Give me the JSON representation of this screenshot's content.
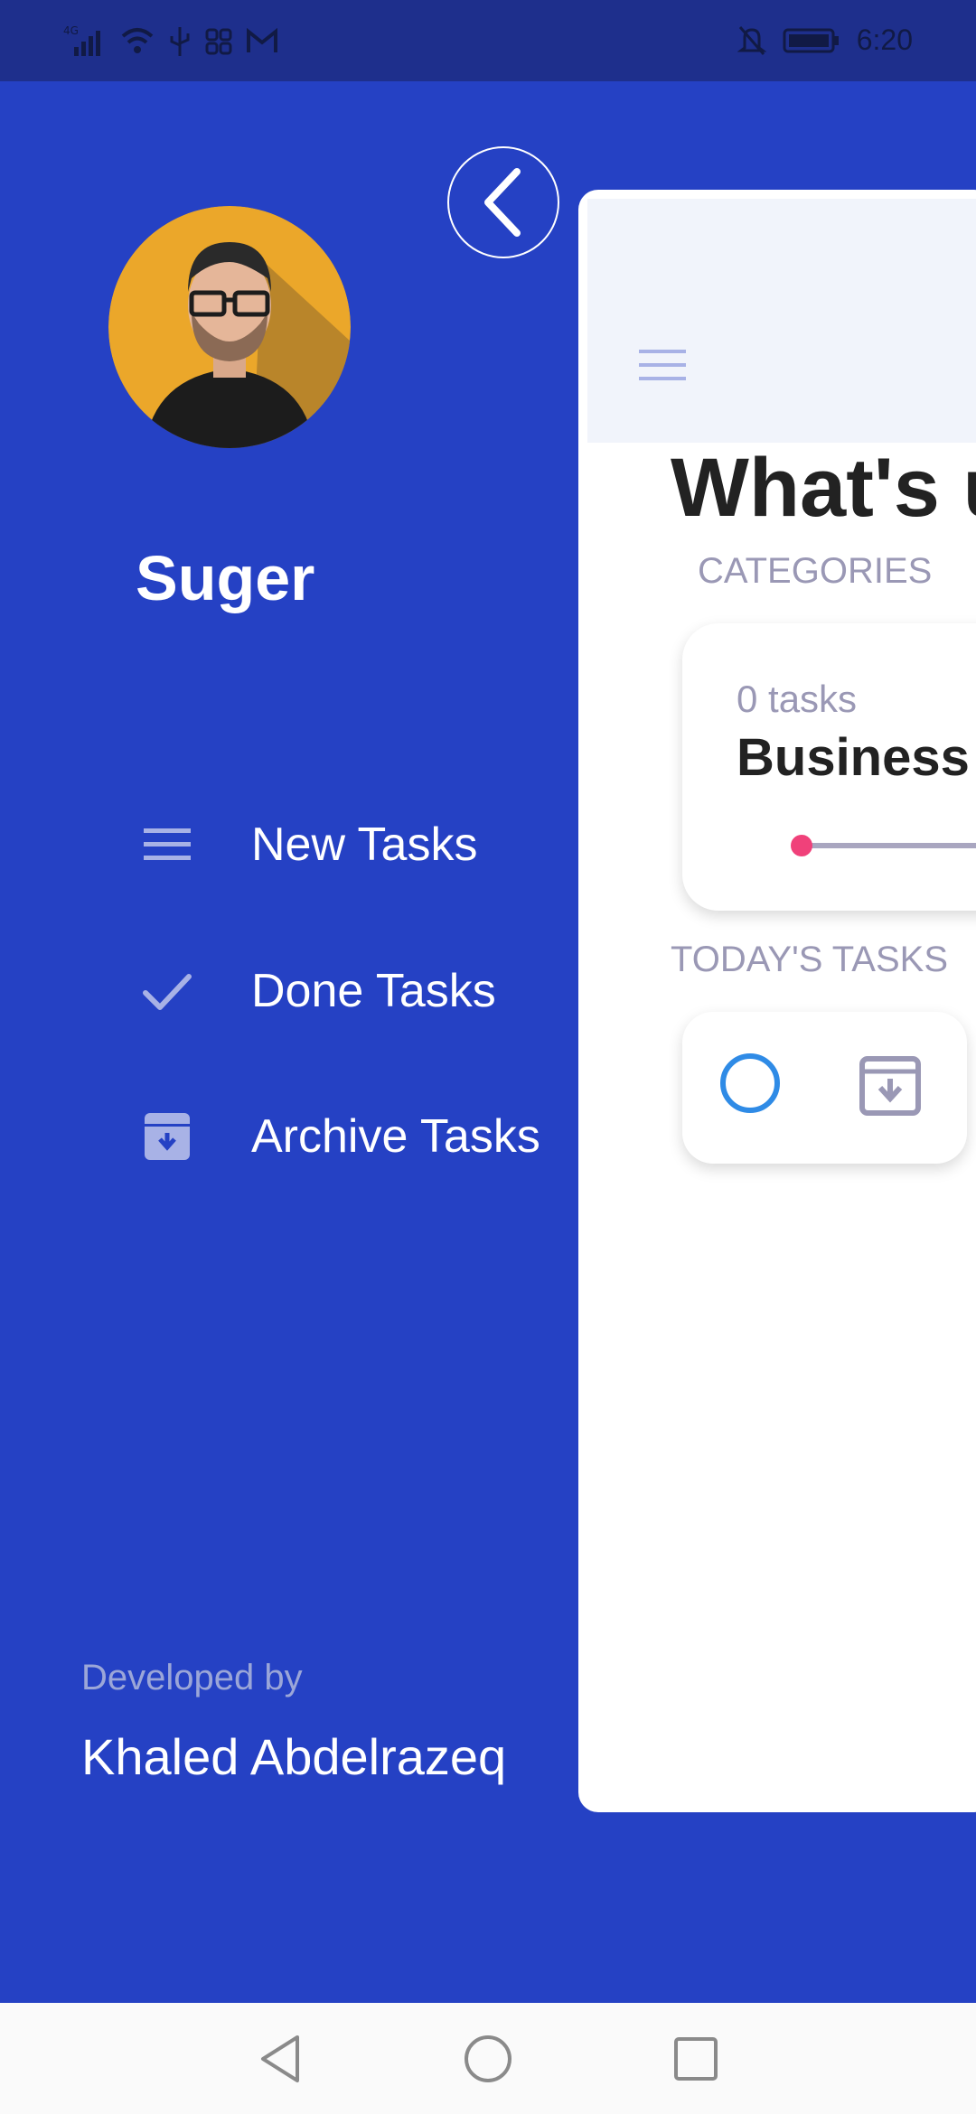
{
  "status_bar": {
    "time": "6:20",
    "left_icons": [
      "signal-icon",
      "wifi-icon",
      "usb-icon",
      "app-icon",
      "gmail-icon"
    ],
    "right_icons": [
      "mute-icon",
      "battery-icon"
    ]
  },
  "drawer": {
    "user_name": "Suger",
    "menu": [
      {
        "label": "New Tasks",
        "icon": "list-icon"
      },
      {
        "label": "Done Tasks",
        "icon": "check-icon"
      },
      {
        "label": "Archive Tasks",
        "icon": "archive-icon"
      }
    ],
    "developed_by_label": "Developed by",
    "developer_name": "Khaled Abdelrazeq"
  },
  "content": {
    "headline": "What's u",
    "categories_label": "CATEGORIES",
    "category": {
      "count": "0 tasks",
      "name": "Business",
      "progress": 0
    },
    "today_label": "TODAY'S TASKS"
  },
  "colors": {
    "drawer_bg": "#2541C4",
    "status_bar_bg": "#1E2F8C",
    "accent_pink": "#F0417A",
    "check_blue": "#2F8BE6"
  }
}
